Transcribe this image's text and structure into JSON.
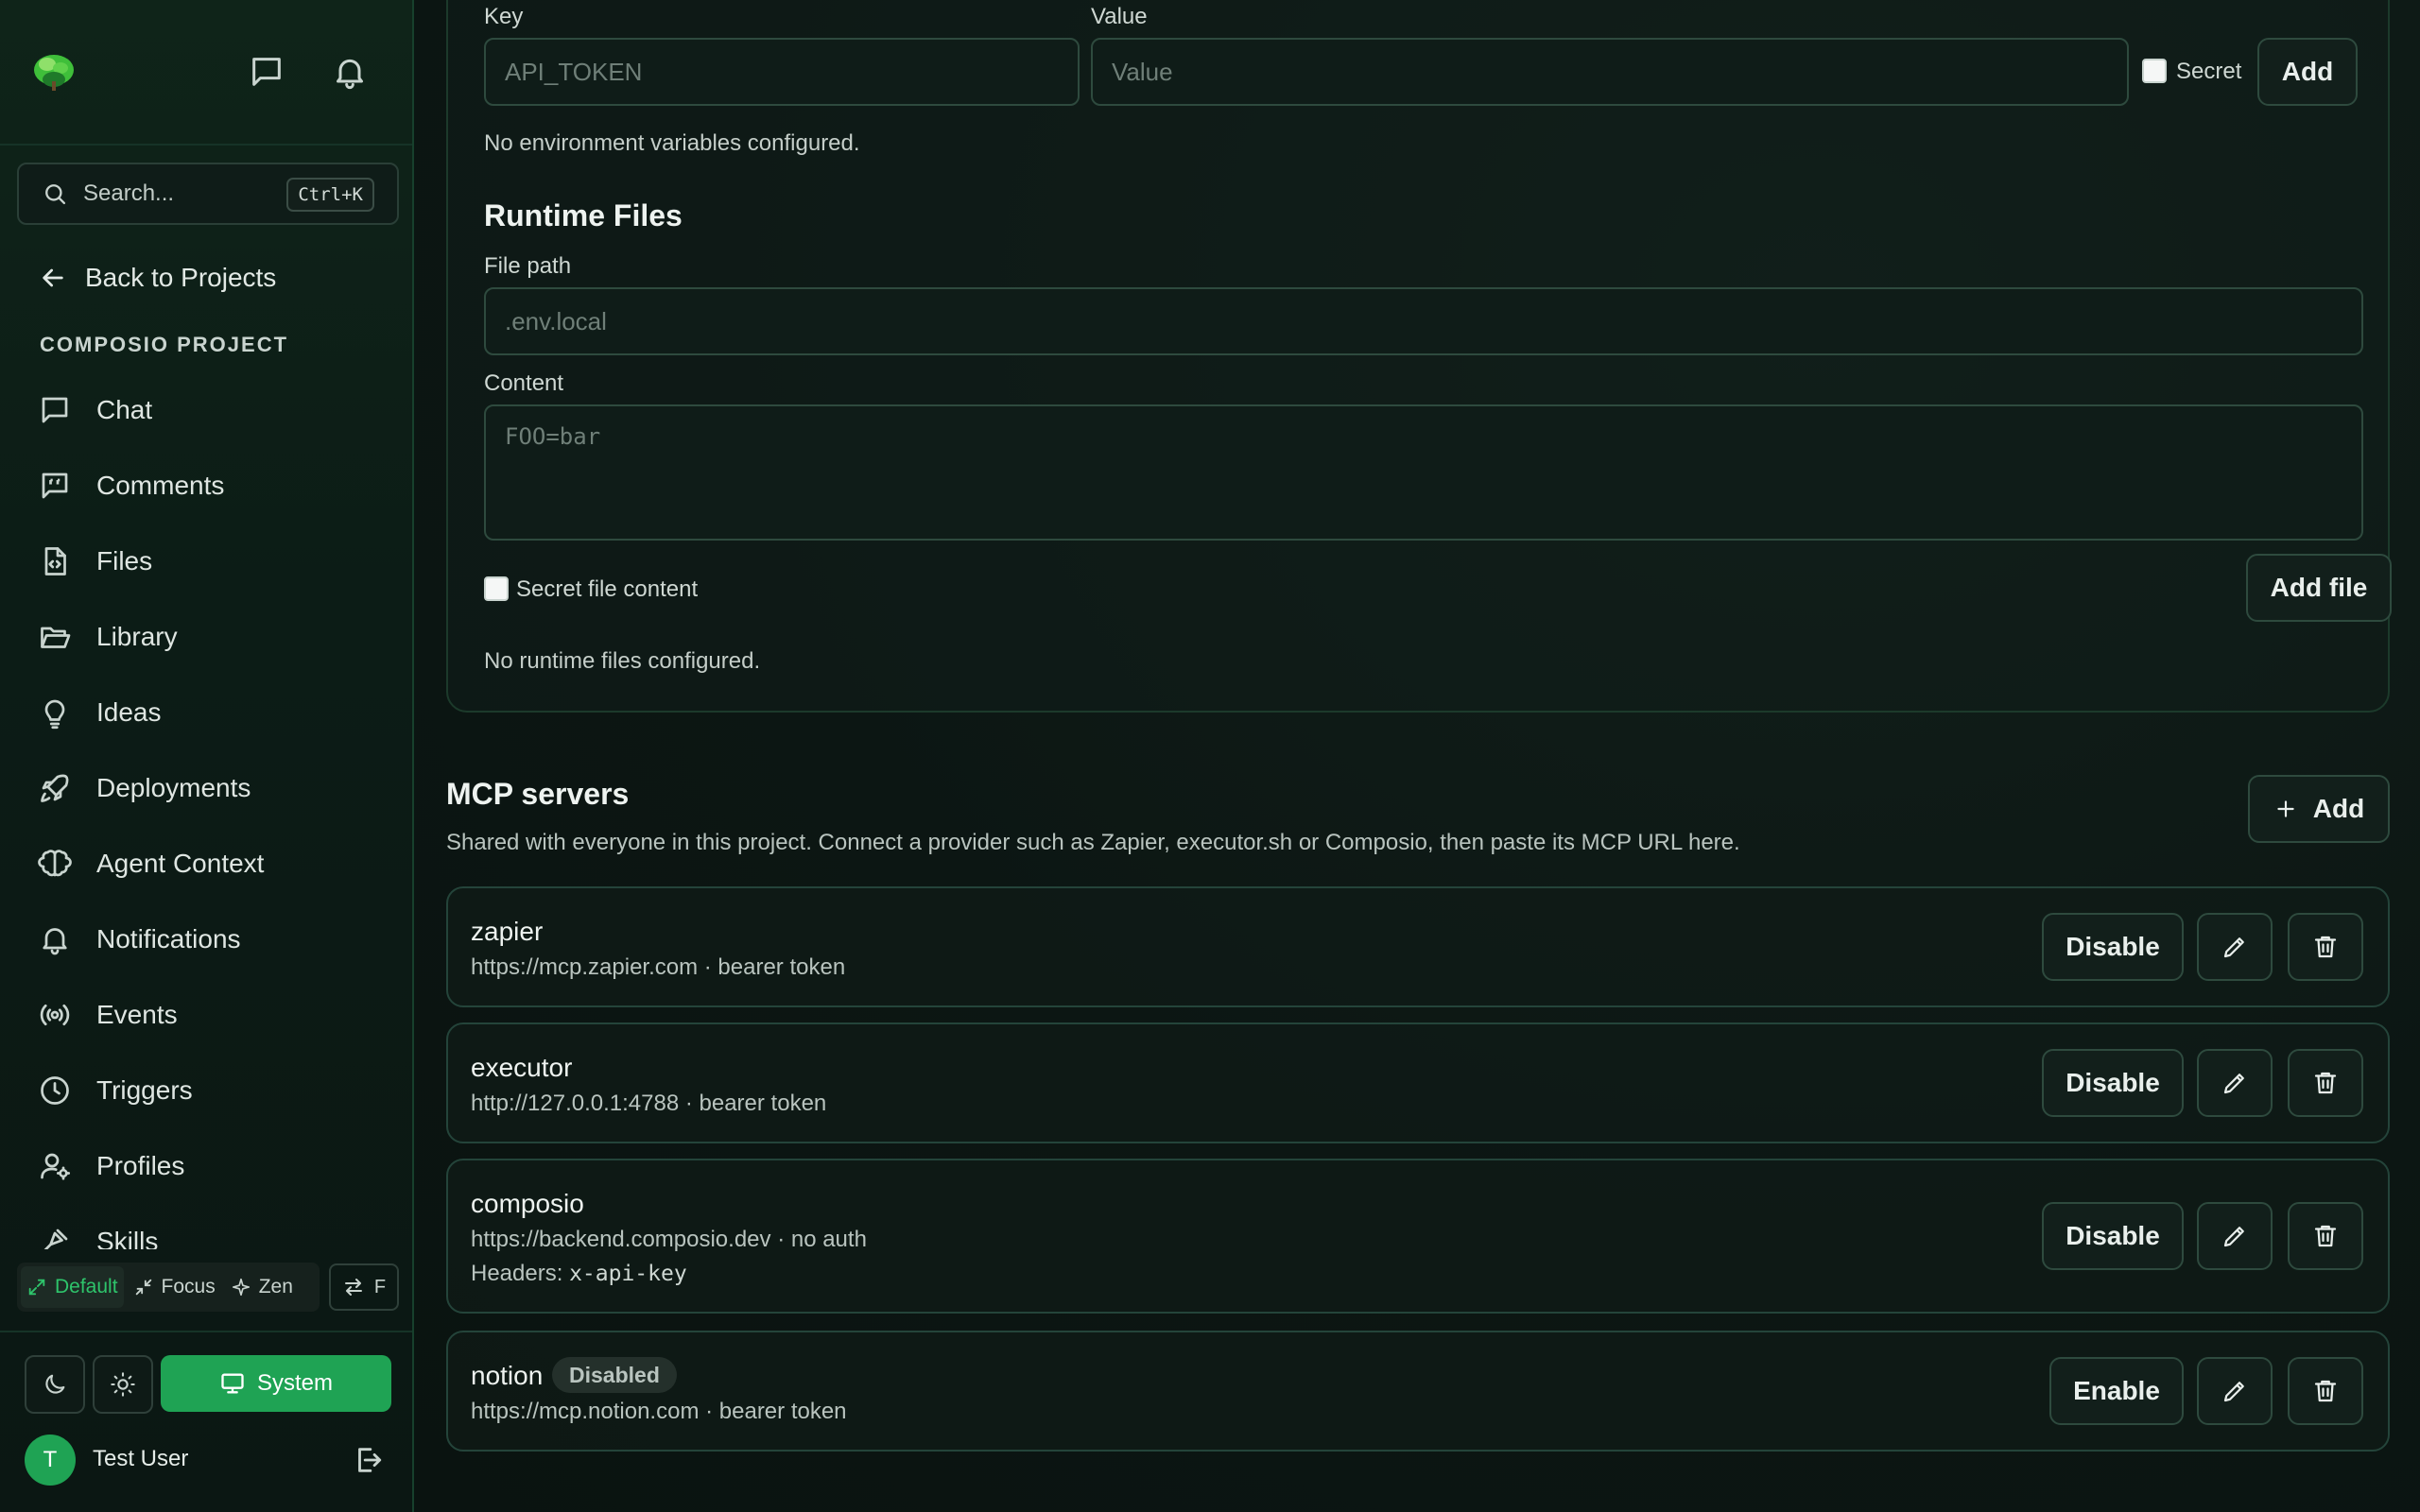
{
  "sidebar": {
    "search": {
      "placeholder": "Search...",
      "shortcut": "Ctrl+K"
    },
    "back_label": "Back to Projects",
    "project_label": "COMPOSIO PROJECT",
    "items": [
      {
        "label": "Chat",
        "icon": "chat-icon"
      },
      {
        "label": "Comments",
        "icon": "comments-icon"
      },
      {
        "label": "Files",
        "icon": "file-code-icon"
      },
      {
        "label": "Library",
        "icon": "folder-open-icon"
      },
      {
        "label": "Ideas",
        "icon": "lightbulb-icon"
      },
      {
        "label": "Deployments",
        "icon": "rocket-icon"
      },
      {
        "label": "Agent Context",
        "icon": "brain-icon"
      },
      {
        "label": "Notifications",
        "icon": "bell-icon"
      },
      {
        "label": "Events",
        "icon": "broadcast-icon"
      },
      {
        "label": "Triggers",
        "icon": "clock-icon"
      },
      {
        "label": "Profiles",
        "icon": "user-gear-icon"
      },
      {
        "label": "Skills",
        "icon": "skills-icon"
      }
    ],
    "modes": [
      {
        "label": "Default",
        "active": true
      },
      {
        "label": "Focus",
        "active": false
      },
      {
        "label": "Zen",
        "active": false
      }
    ],
    "swap_label": "F",
    "theme": {
      "system_label": "System"
    },
    "user": {
      "initial": "T",
      "name": "Test User"
    }
  },
  "env": {
    "key_label": "Key",
    "key_placeholder": "API_TOKEN",
    "value_label": "Value",
    "value_placeholder": "Value",
    "secret_label": "Secret",
    "add_label": "Add",
    "empty_text": "No environment variables configured."
  },
  "runtime": {
    "title": "Runtime Files",
    "path_label": "File path",
    "path_placeholder": ".env.local",
    "content_label": "Content",
    "content_placeholder": "FOO=bar",
    "secret_label": "Secret file content",
    "add_label": "Add file",
    "empty_text": "No runtime files configured."
  },
  "mcp": {
    "title": "MCP servers",
    "description": "Shared with everyone in this project. Connect a provider such as Zapier, executor.sh or Composio, then paste its MCP URL here.",
    "add_label": "Add",
    "servers": [
      {
        "name": "zapier",
        "details": "https://mcp.zapier.com · bearer token",
        "action": "Disable"
      },
      {
        "name": "executor",
        "details": "http://127.0.0.1:4788 · bearer token",
        "action": "Disable"
      },
      {
        "name": "composio",
        "details": "https://backend.composio.dev · no auth",
        "headers_label": "Headers:",
        "headers_value": "x-api-key",
        "action": "Disable"
      },
      {
        "name": "notion",
        "badge": "Disabled",
        "details": "https://mcp.notion.com · bearer token",
        "action": "Enable"
      }
    ]
  },
  "colors": {
    "accent": "#1fa354",
    "accent_text": "#2ec46b",
    "background": "#0b1512"
  }
}
